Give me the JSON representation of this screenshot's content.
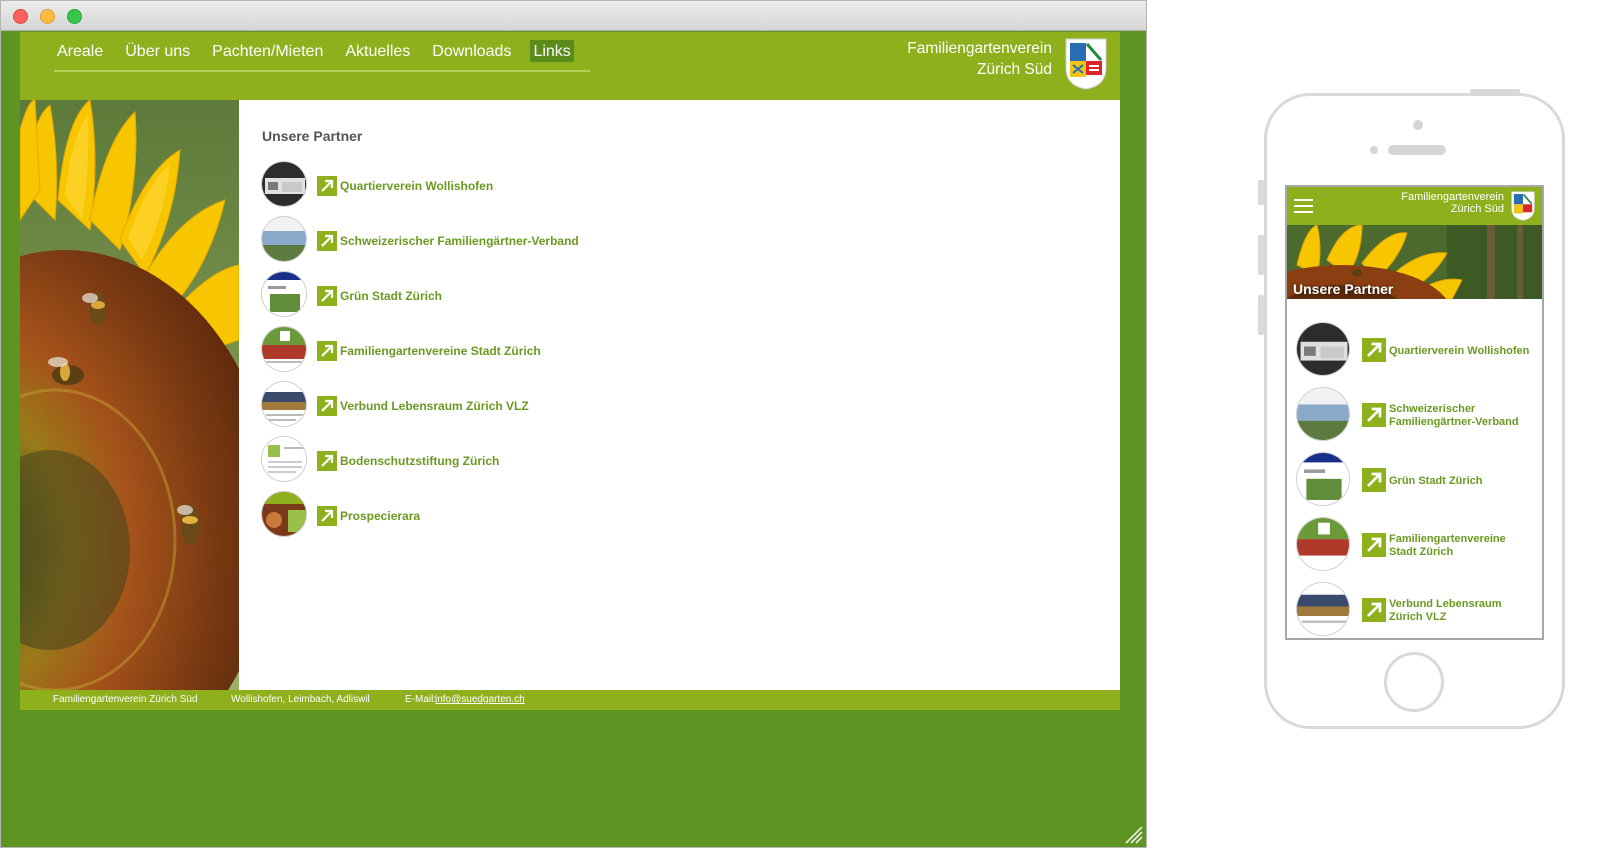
{
  "desktop": {
    "nav": [
      {
        "label": "Areale"
      },
      {
        "label": "Über uns"
      },
      {
        "label": "Pachten/Mieten"
      },
      {
        "label": "Aktuelles"
      },
      {
        "label": "Downloads"
      },
      {
        "label": "Links",
        "active": true
      }
    ],
    "brand_line1": "Familiengartenverein",
    "brand_line2": "Zürich Süd",
    "content_title": "Unsere Partner",
    "partners": [
      {
        "label": "Quartierverein Wollishofen"
      },
      {
        "label": "Schweizerischer Familiengärtner-Verband"
      },
      {
        "label": "Grün Stadt Zürich"
      },
      {
        "label": "Familiengartenvereine Stadt Zürich"
      },
      {
        "label": "Verbund Lebensraum Zürich VLZ"
      },
      {
        "label": "Bodenschutzstiftung Zürich"
      },
      {
        "label": "Prospecierara"
      }
    ],
    "footer": {
      "org": "Familiengartenverein Zürich Süd",
      "areas": "Wollishofen, Leimbach, Adliswil",
      "email_label": "E-Mail:",
      "email": "info@suedgarten.ch"
    }
  },
  "mobile": {
    "brand_line1": "Familiengartenverein",
    "brand_line2": "Zürich Süd",
    "title": "Unsere Partner",
    "partners": [
      {
        "line1": "Quartierverein Wollishofen",
        "line2": ""
      },
      {
        "line1": "Schweizerischer",
        "line2": "Familiengärtner-Verband"
      },
      {
        "line1": "Grün Stadt Zürich",
        "line2": ""
      },
      {
        "line1": "Familiengartenvereine",
        "line2": "Stadt Zürich"
      },
      {
        "line1": "Verbund Lebensraum",
        "line2": "Zürich VLZ"
      }
    ]
  },
  "colors": {
    "brand_green": "#8fb01d",
    "dark_green": "#5e9422",
    "link_green": "#6a9a22"
  },
  "icons": [
    "hamburger-icon",
    "external-link-arrow-icon",
    "crest-logo"
  ]
}
